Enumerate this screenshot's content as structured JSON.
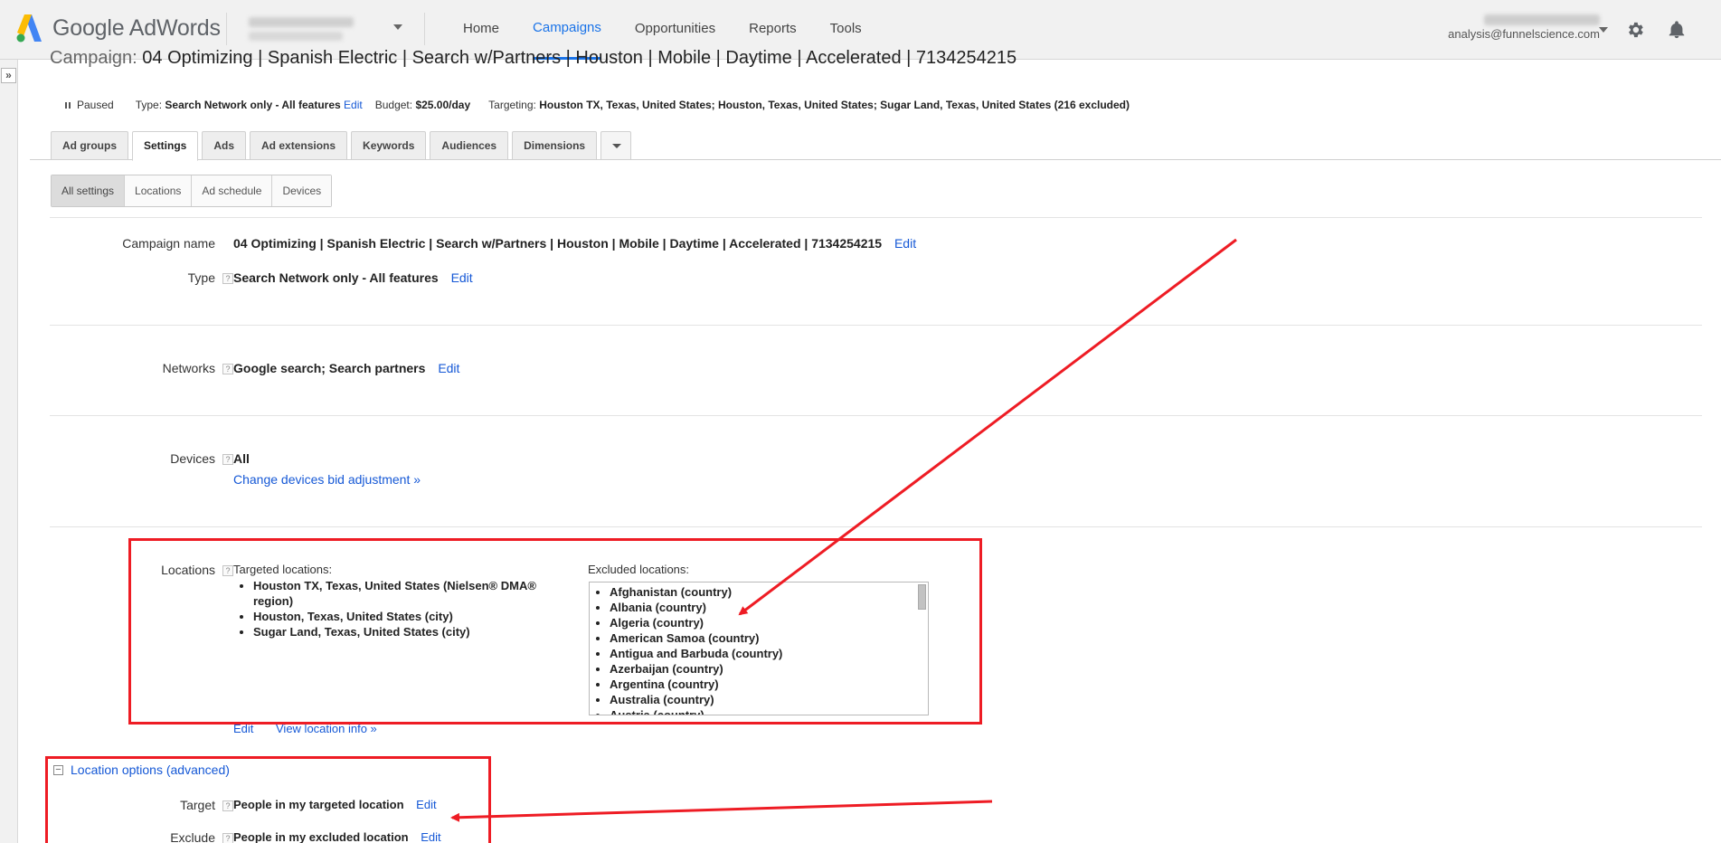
{
  "header": {
    "logo_text": "Google AdWords",
    "nav": [
      {
        "label": "Home",
        "active": false
      },
      {
        "label": "Campaigns",
        "active": true
      },
      {
        "label": "Opportunities",
        "active": false
      },
      {
        "label": "Reports",
        "active": false
      },
      {
        "label": "Tools",
        "active": false
      }
    ],
    "user_email": "analysis@funnelscience.com",
    "accent_color": "#1a73e8"
  },
  "campaign": {
    "title_label": "Campaign:",
    "title": "04 Optimizing | Spanish Electric | Search w/Partners | Houston | Mobile | Daytime | Accelerated | 7134254215",
    "status": "Paused",
    "type_label": "Type:",
    "type_value": "Search Network only - All features",
    "type_edit": "Edit",
    "budget_label": "Budget:",
    "budget_value": "$25.00/day",
    "targeting_label": "Targeting:",
    "targeting_value": "Houston TX, Texas, United States; Houston, Texas, United States; Sugar Land, Texas, United States (216 excluded)"
  },
  "tabs": [
    "Ad groups",
    "Settings",
    "Ads",
    "Ad extensions",
    "Keywords",
    "Audiences",
    "Dimensions"
  ],
  "active_tab": "Settings",
  "subtabs": [
    "All settings",
    "Locations",
    "Ad schedule",
    "Devices"
  ],
  "active_subtab": "All settings",
  "settings": {
    "campaign_name_label": "Campaign name",
    "campaign_name_value": "04 Optimizing | Spanish Electric | Search w/Partners | Houston | Mobile | Daytime | Accelerated | 7134254215",
    "type_label": "Type",
    "type_value": "Search Network only - All features",
    "networks_label": "Networks",
    "networks_value": "Google search; Search partners",
    "devices_label": "Devices",
    "devices_value": "All",
    "devices_link": "Change devices bid adjustment »",
    "locations_label": "Locations",
    "targeted_heading": "Targeted locations:",
    "targeted": [
      "Houston TX, Texas, United States (Nielsen® DMA®",
      "region)",
      "Houston, Texas, United States (city)",
      "Sugar Land, Texas, United States (city)"
    ],
    "excluded_heading": "Excluded locations:",
    "excluded": [
      "Afghanistan (country)",
      "Albania (country)",
      "Algeria (country)",
      "American Samoa (country)",
      "Antigua and Barbuda (country)",
      "Azerbaijan (country)",
      "Argentina (country)",
      "Australia (country)",
      "Austria (country)"
    ],
    "loc_edit": "Edit",
    "view_location_info": "View location info »",
    "location_options": "Location options (advanced)",
    "target_label": "Target",
    "target_value": "People in my targeted location",
    "exclude_label": "Exclude",
    "exclude_value": "People in my excluded location",
    "edit": "Edit",
    "help": "?"
  },
  "annotation_color": "#ee1c24"
}
